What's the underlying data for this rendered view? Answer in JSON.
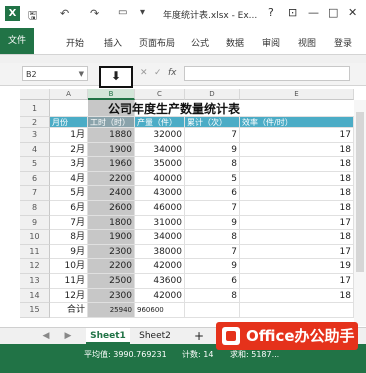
{
  "window": {
    "title": "年度统计表.xlsx - Ex...",
    "help": "?",
    "restore": "⊡",
    "minimize": "—",
    "maximize": "□",
    "close": "✕"
  },
  "quick_access": {
    "save_icon": "save-icon",
    "undo": "↶",
    "redo": "↷",
    "open": "📂",
    "save": "💾"
  },
  "ribbon": {
    "file": "文件",
    "tabs": [
      "开始",
      "插入",
      "页面布局",
      "公式",
      "数据",
      "审阅",
      "视图",
      "登录"
    ]
  },
  "formula_bar": {
    "name_box": "B2",
    "cancel": "✕",
    "enter": "✓",
    "fx": "fx",
    "value": ""
  },
  "sheet": {
    "columns": [
      "A",
      "B",
      "C",
      "D",
      "E"
    ],
    "title": "公司年度生产数量统计表",
    "headers": [
      "月份",
      "工时（时）",
      "产量（件）",
      "累计（次）",
      "效率（件/时）"
    ],
    "rows": [
      [
        "1月",
        "1880",
        "32000",
        "7",
        "17"
      ],
      [
        "2月",
        "1900",
        "34000",
        "9",
        "18"
      ],
      [
        "3月",
        "1960",
        "35000",
        "8",
        "18"
      ],
      [
        "4月",
        "2200",
        "40000",
        "5",
        "18"
      ],
      [
        "5月",
        "2400",
        "43000",
        "6",
        "18"
      ],
      [
        "6月",
        "2600",
        "46000",
        "7",
        "18"
      ],
      [
        "7月",
        "1800",
        "31000",
        "9",
        "17"
      ],
      [
        "8月",
        "1900",
        "34000",
        "8",
        "18"
      ],
      [
        "9月",
        "2300",
        "38000",
        "7",
        "17"
      ],
      [
        "10月",
        "2200",
        "42000",
        "9",
        "19"
      ],
      [
        "11月",
        "2500",
        "43600",
        "6",
        "17"
      ],
      [
        "12月",
        "2300",
        "42000",
        "8",
        "18"
      ]
    ],
    "total_label": "合计",
    "total_b": "25940",
    "total_c": "960600",
    "row_numbers": [
      "1",
      "2",
      "3",
      "4",
      "5",
      "6",
      "7",
      "8",
      "9",
      "10",
      "11",
      "12",
      "13",
      "14",
      "15"
    ]
  },
  "sheet_tabs": [
    "Sheet1",
    "Sheet2"
  ],
  "add_sheet": "+",
  "status": {
    "average": "平均值: 3990.769231",
    "count": "计数: 14",
    "sum_partial": "求和: 5187..."
  },
  "watermark": "Office办公助手",
  "colors": {
    "excel_green": "#217346",
    "header_blue": "#4bacc6",
    "watermark_red": "#e5321b"
  }
}
